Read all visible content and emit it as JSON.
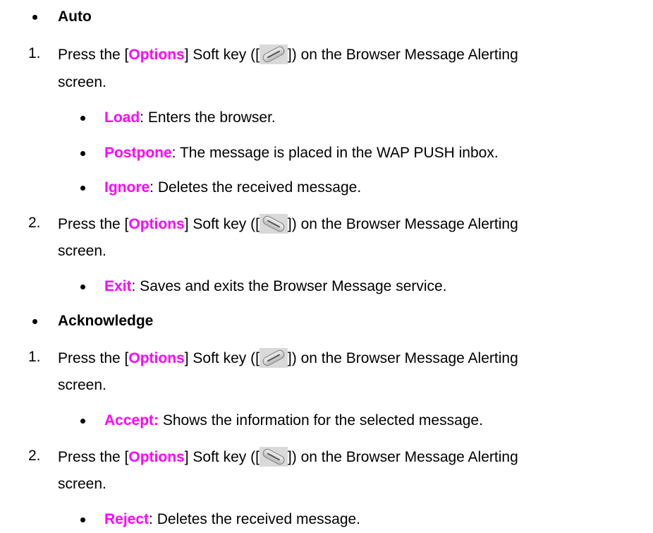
{
  "colors": {
    "keyword": "#ff00ff",
    "text": "#000000"
  },
  "sections": [
    {
      "heading": "Auto",
      "steps": [
        {
          "number": "1.",
          "line1_pre": "Press the [",
          "key_label": "Options",
          "line1_mid": "] Soft key ([",
          "icon": "left-soft-key-icon",
          "line1_post": "]) on the Browser Message Alerting",
          "line2": "screen.",
          "options": [
            {
              "term": "Load",
              "desc": ": Enters the browser."
            },
            {
              "term": "Postpone",
              "desc": ": The message is placed in the WAP PUSH inbox."
            },
            {
              "term": "Ignore",
              "desc": ": Deletes the received message."
            }
          ]
        },
        {
          "number": "2.",
          "line1_pre": "Press the [",
          "key_label": "Options",
          "line1_mid": "] Soft key ([",
          "icon": "right-soft-key-icon",
          "line1_post": "]) on the Browser Message Alerting",
          "line2": "screen.",
          "options": [
            {
              "term": "Exit",
              "desc": ": Saves and exits the Browser Message service."
            }
          ]
        }
      ]
    },
    {
      "heading": "Acknowledge",
      "steps": [
        {
          "number": "1.",
          "line1_pre": "Press the [",
          "key_label": "Options",
          "line1_mid": "] Soft key ([",
          "icon": "left-soft-key-icon",
          "line1_post": "]) on the Browser Message Alerting",
          "line2": "screen.",
          "options": [
            {
              "term": "Accept:",
              "desc": " Shows the information for the selected message."
            }
          ]
        },
        {
          "number": "2.",
          "line1_pre": "Press the [",
          "key_label": "Options",
          "line1_mid": "] Soft key ([",
          "icon": "right-soft-key-icon",
          "line1_post": "]) on the Browser Message Alerting",
          "line2": "screen.",
          "options": [
            {
              "term": "Reject",
              "desc": ": Deletes the received message."
            }
          ]
        }
      ]
    }
  ]
}
